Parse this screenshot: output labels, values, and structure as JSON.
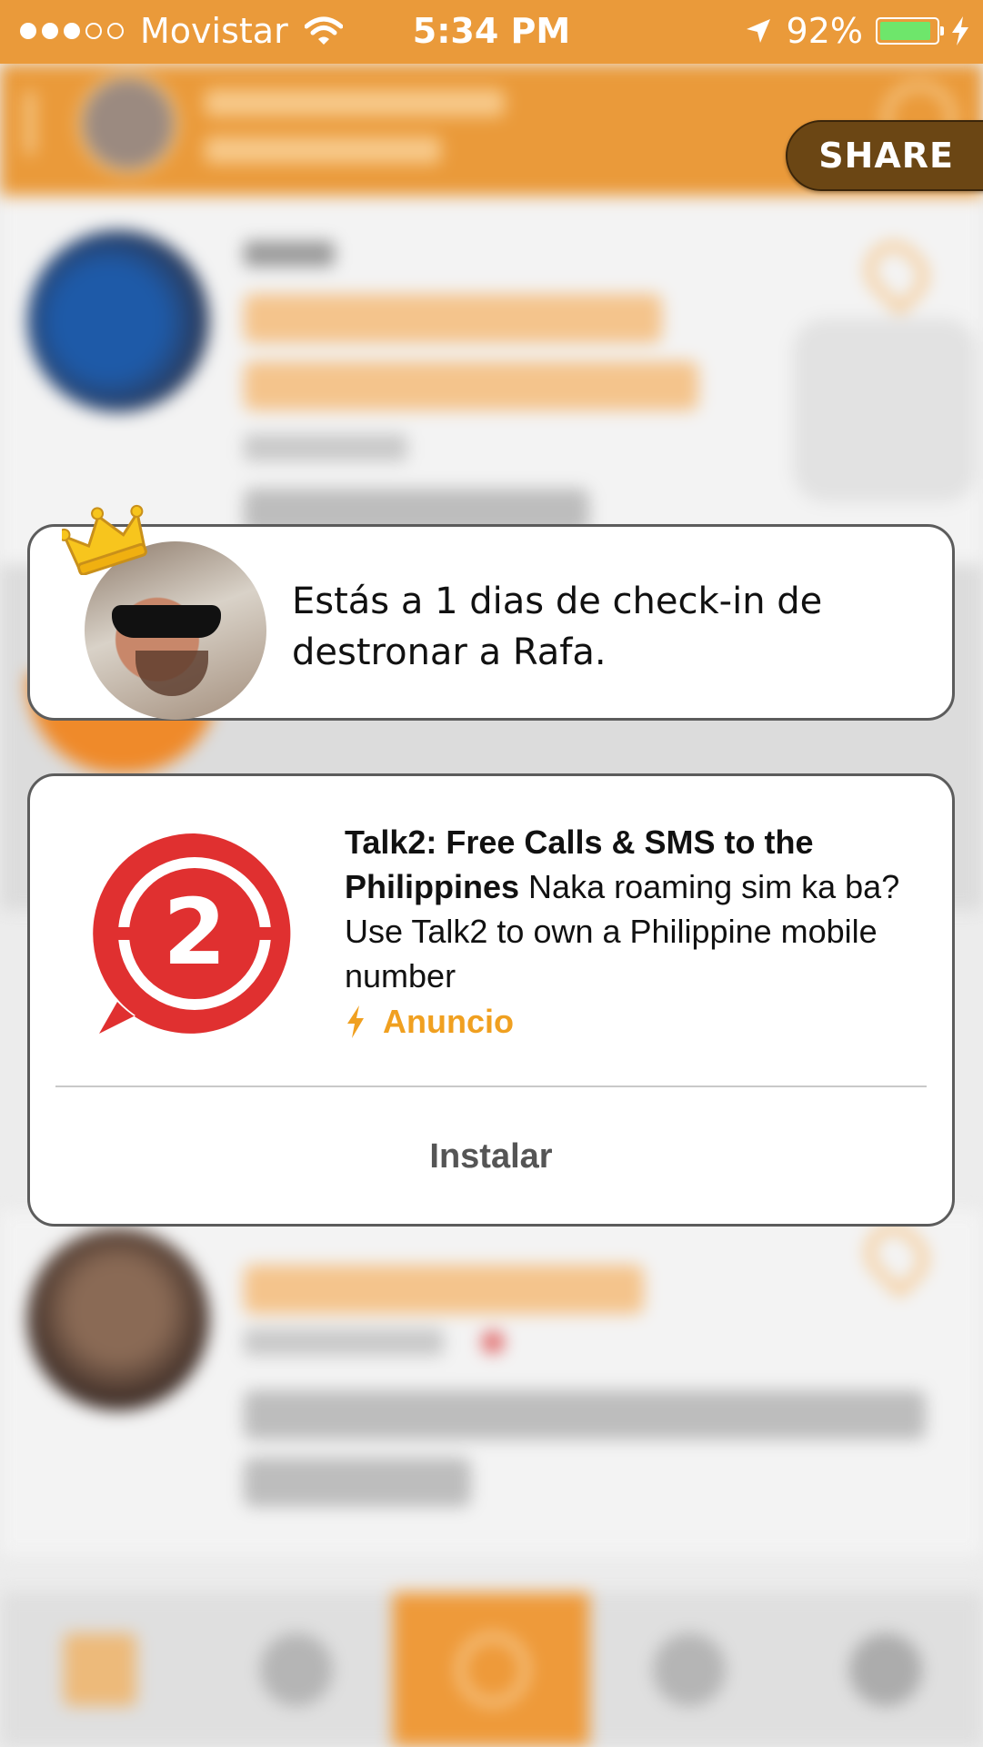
{
  "status_bar": {
    "carrier": "Movistar",
    "time": "5:34 PM",
    "battery": "92%",
    "battery_level": 0.92,
    "signal_bars_filled": 3,
    "signal_bars_total": 5
  },
  "share_label": "SHARE",
  "king_card": {
    "message": "Estás a 1 dias de check-in de destronar a Rafa."
  },
  "ad_card": {
    "title": "Talk2: Free Calls & SMS to the Philippines",
    "body": "Naka roaming sim ka ba? Use Talk2 to own a Philippine mobile number",
    "label": "Anuncio",
    "install_label": "Instalar",
    "logo_number": "2"
  },
  "colors": {
    "brand_orange": "#ea9a3a",
    "ad_label": "#f0a020",
    "logo_red": "#e03030"
  }
}
